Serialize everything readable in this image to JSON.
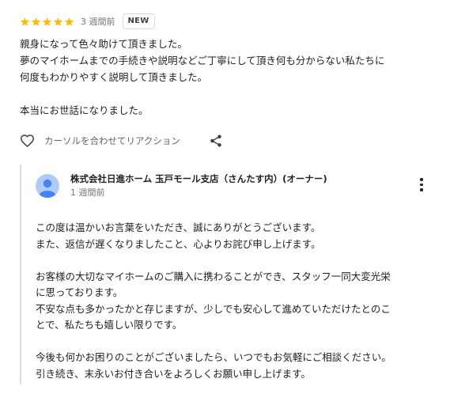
{
  "review": {
    "rating": 5,
    "time": "3 週間前",
    "badge": "NEW",
    "lines": [
      "親身になって色々助けて頂きました。",
      "夢のマイホームまでの手続きや説明などご丁寧にして頂き何も分からない私たちに",
      "何度もわかりやすく説明して頂きました。",
      "",
      "本当にお世話になりました。"
    ],
    "reaction_label": "カーソルを合わせてリアクション",
    "icons": {
      "star": "star-icon",
      "heart": "heart-outline-icon",
      "share": "share-icon"
    },
    "star_color": "#fbbc04"
  },
  "owner": {
    "name": "株式会社日進ホーム 玉戸モール支店（さんたす内）(オーナー)",
    "time": "1 週間前",
    "avatar_color": "#aecbfa",
    "icons": {
      "avatar": "person-avatar-icon",
      "more": "more-vert-icon"
    },
    "lines": [
      "この度は温かいお言葉をいただき、誠にありがとうございます。",
      "また、返信が遅くなりましたこと、心よりお詫び申し上げます。",
      "",
      "お客様の大切なマイホームのご購入に携わることができ、スタッフ一同大変光栄",
      "に思っております。",
      "不安な点も多かったかと存じますが、少しでも安心して進めていただけたとのこ",
      "とで、私たちも嬉しい限りです。",
      "",
      "今後も何かお困りのことがございましたら、いつでもお気軽にご相談ください。",
      "引き続き、末永いお付き合いをよろしくお願い申し上げます。"
    ]
  }
}
